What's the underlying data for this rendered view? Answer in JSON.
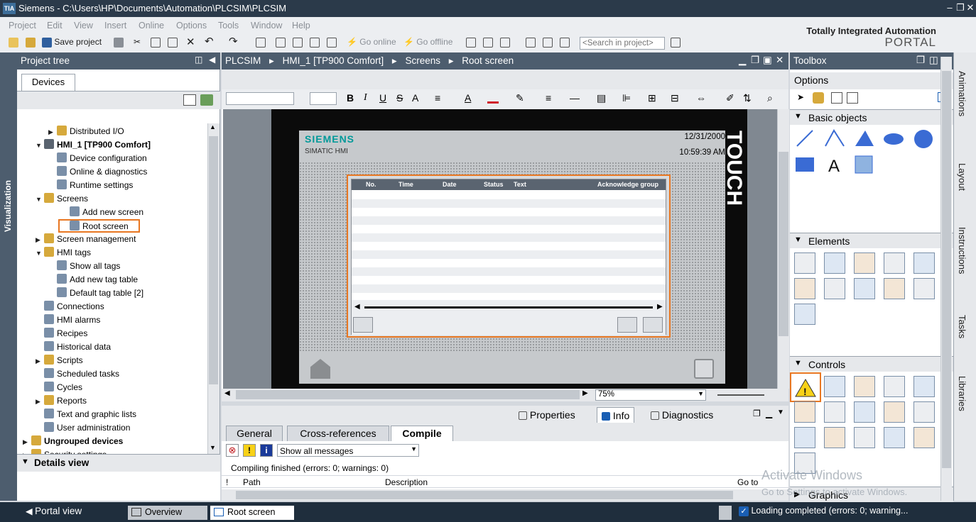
{
  "app": {
    "title": "Siemens  -  C:\\Users\\HP\\Documents\\Automation\\PLCSIM\\PLCSIM",
    "logo": "TIA",
    "brand_line1": "Totally Integrated Automation",
    "brand_line2": "PORTAL"
  },
  "menu": [
    "Project",
    "Edit",
    "View",
    "Insert",
    "Online",
    "Options",
    "Tools",
    "Window",
    "Help"
  ],
  "toolbar": {
    "save_label": "Save project",
    "go_online": "Go online",
    "go_offline": "Go offline",
    "search_placeholder": "<Search in project>"
  },
  "left_vtab": "Visualization",
  "project_tree": {
    "title": "Project tree",
    "devices_tab": "Devices",
    "items": [
      {
        "label": "Distributed I/O",
        "arrow": "▶",
        "icon": "folder-icon",
        "bold": false
      },
      {
        "label": "HMI_1 [TP900 Comfort]",
        "arrow": "▼",
        "icon": "hmi-device-icon",
        "bold": true
      },
      {
        "label": "Device configuration",
        "arrow": "",
        "icon": "device-config-icon",
        "bold": false
      },
      {
        "label": "Online & diagnostics",
        "arrow": "",
        "icon": "diagnostics-icon",
        "bold": false
      },
      {
        "label": "Runtime settings",
        "arrow": "",
        "icon": "runtime-settings-icon",
        "bold": false
      },
      {
        "label": "Screens",
        "arrow": "▼",
        "icon": "folder-icon",
        "bold": false
      },
      {
        "label": "Add new screen",
        "arrow": "",
        "icon": "add-screen-icon",
        "bold": false
      },
      {
        "label": "Root screen",
        "arrow": "",
        "icon": "screen-icon",
        "bold": false
      },
      {
        "label": "Screen management",
        "arrow": "▶",
        "icon": "folder-icon",
        "bold": false
      },
      {
        "label": "HMI tags",
        "arrow": "▼",
        "icon": "folder-icon",
        "bold": false
      },
      {
        "label": "Show all tags",
        "arrow": "",
        "icon": "tags-icon",
        "bold": false
      },
      {
        "label": "Add new tag table",
        "arrow": "",
        "icon": "add-tag-table-icon",
        "bold": false
      },
      {
        "label": "Default tag table [2]",
        "arrow": "",
        "icon": "tag-table-icon",
        "bold": false
      },
      {
        "label": "Connections",
        "arrow": "",
        "icon": "connections-icon",
        "bold": false
      },
      {
        "label": "HMI alarms",
        "arrow": "",
        "icon": "alarms-icon",
        "bold": false
      },
      {
        "label": "Recipes",
        "arrow": "",
        "icon": "recipes-icon",
        "bold": false
      },
      {
        "label": "Historical data",
        "arrow": "",
        "icon": "historical-data-icon",
        "bold": false
      },
      {
        "label": "Scripts",
        "arrow": "▶",
        "icon": "folder-icon",
        "bold": false
      },
      {
        "label": "Scheduled tasks",
        "arrow": "",
        "icon": "scheduled-tasks-icon",
        "bold": false
      },
      {
        "label": "Cycles",
        "arrow": "",
        "icon": "cycles-icon",
        "bold": false
      },
      {
        "label": "Reports",
        "arrow": "▶",
        "icon": "folder-icon",
        "bold": false
      },
      {
        "label": "Text and graphic lists",
        "arrow": "",
        "icon": "text-lists-icon",
        "bold": false
      },
      {
        "label": "User administration",
        "arrow": "",
        "icon": "user-admin-icon",
        "bold": false
      },
      {
        "label": "Ungrouped devices",
        "arrow": "▶",
        "icon": "folder-icon",
        "bold": true
      },
      {
        "label": "Security settings",
        "arrow": "▶",
        "icon": "folder-icon",
        "bold": false
      }
    ]
  },
  "details_view": "Details view",
  "editor": {
    "breadcrumb": [
      "PLCSIM",
      "HMI_1 [TP900 Comfort]",
      "Screens",
      "Root screen"
    ],
    "hmi": {
      "brand": "SIEMENS",
      "model": "SIMATIC HMI",
      "date": "12/31/2000",
      "time": "10:59:39 AM",
      "side_label": "TOUCH"
    },
    "alarm_columns": [
      "No.",
      "Time",
      "Date",
      "Status",
      "Text",
      "Acknowledge group"
    ],
    "zoom": "75%"
  },
  "properties": {
    "tabs": [
      "Properties",
      "Info",
      "Diagnostics"
    ],
    "subtabs": [
      "General",
      "Cross-references",
      "Compile"
    ],
    "filter": "Show all messages",
    "message": "Compiling finished (errors: 0; warnings: 0)",
    "columns": [
      "!",
      "Path",
      "Description",
      "Go to"
    ]
  },
  "toolbox": {
    "title": "Toolbox",
    "options": "Options",
    "sections": [
      "Basic objects",
      "Elements",
      "Controls",
      "Graphics"
    ]
  },
  "right_tabs": [
    "Animations",
    "Layout",
    "Instructions",
    "Tasks",
    "Libraries"
  ],
  "statusbar": {
    "portal_view": "Portal view",
    "overview": "Overview",
    "root_screen": "Root screen",
    "status": "Loading completed (errors: 0; warning..."
  },
  "watermark": {
    "line1": "Activate Windows",
    "line2": "Go to Settings to activate Windows."
  },
  "colors": {
    "title_bg": "#2b3a4a",
    "panel_header": "#4d5d6e",
    "highlight": "#e87722",
    "siemens_teal": "#009999"
  }
}
